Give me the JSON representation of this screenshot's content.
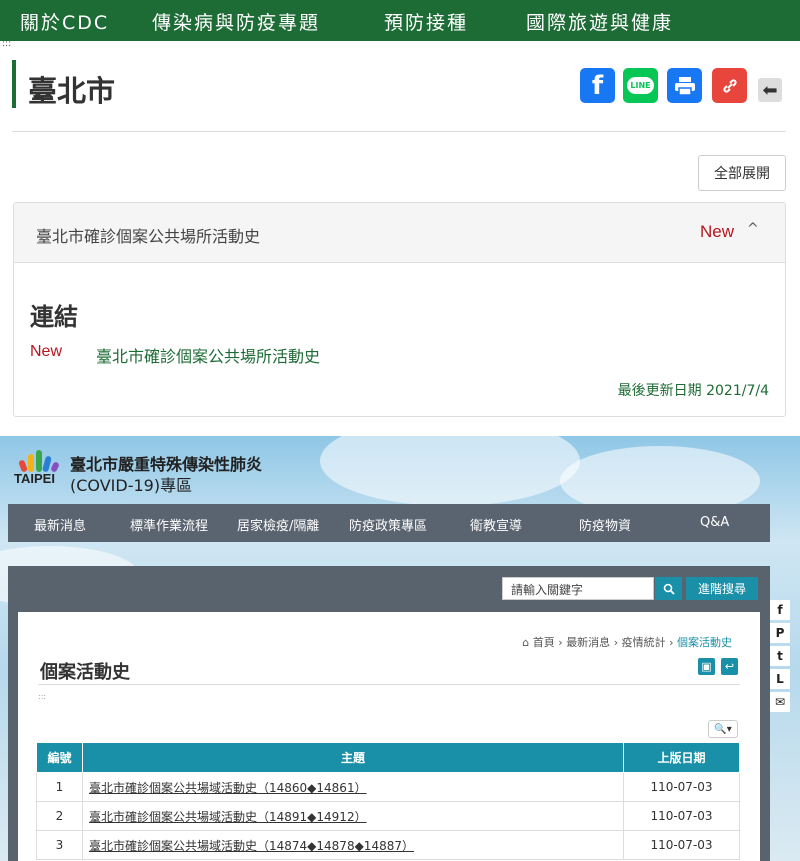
{
  "top_nav": {
    "items": [
      {
        "label": "關於CDC"
      },
      {
        "label": "傳染病與防疫專題"
      },
      {
        "label": "預防接種"
      },
      {
        "label": "國際旅遊與健康"
      }
    ]
  },
  "page": {
    "title": "臺北市",
    "expand_all_label": "全部展開"
  },
  "share": {
    "facebook_glyph": "f",
    "line_label": "LINE",
    "print_glyph": "🖶",
    "link_glyph": "🔗",
    "back_glyph": "⬅"
  },
  "panel": {
    "title": "臺北市確診個案公共場所活動史",
    "new_badge": "New",
    "caret": "^",
    "links_heading": "連結",
    "link_new_badge": "New",
    "link_text": "臺北市確診個案公共場所活動史",
    "updated": "最後更新日期 2021/7/4"
  },
  "site": {
    "logo_text": "TAIPEI",
    "title_line1": "臺北市嚴重特殊傳染性肺炎",
    "title_line2": "(COVID-19)專區"
  },
  "main_nav": {
    "items": [
      {
        "label": "最新消息"
      },
      {
        "label": "標準作業流程"
      },
      {
        "label": "居家檢疫/隔離"
      },
      {
        "label": "防疫政策專區"
      },
      {
        "label": "衛教宣導"
      },
      {
        "label": "防疫物資"
      },
      {
        "label": "Q&A"
      }
    ]
  },
  "search": {
    "placeholder": "請輸入關鍵字",
    "button_glyph": "🔍",
    "advanced_label": "進階搜尋"
  },
  "breadcrumb": {
    "home": "首頁",
    "items": [
      "最新消息",
      "疫情統計",
      "個案活動史"
    ]
  },
  "content": {
    "title": "個案活動史",
    "zoom_label": "🔍▾",
    "table": {
      "headers": [
        "編號",
        "主題",
        "上版日期"
      ],
      "rows": [
        {
          "no": "1",
          "topic": "臺北市確診個案公共場域活動史（14860◆14861）",
          "date": "110-07-03"
        },
        {
          "no": "2",
          "topic": "臺北市確診個案公共場域活動史（14891◆14912）",
          "date": "110-07-03"
        },
        {
          "no": "3",
          "topic": "臺北市確診個案公共場域活動史（14874◆14878◆14887）",
          "date": "110-07-03"
        }
      ]
    }
  },
  "side_social": [
    {
      "icon": "facebook-icon",
      "glyph": "f"
    },
    {
      "icon": "plurk-icon",
      "glyph": "P"
    },
    {
      "icon": "twitter-icon",
      "glyph": "t"
    },
    {
      "icon": "line-icon",
      "glyph": "L"
    },
    {
      "icon": "email-icon",
      "glyph": "✉"
    }
  ],
  "colors": {
    "cdc_green": "#1d6b35",
    "new_red": "#b5161e",
    "taipei_teal": "#1a8fa8",
    "nav_gray": "#5a6470"
  }
}
